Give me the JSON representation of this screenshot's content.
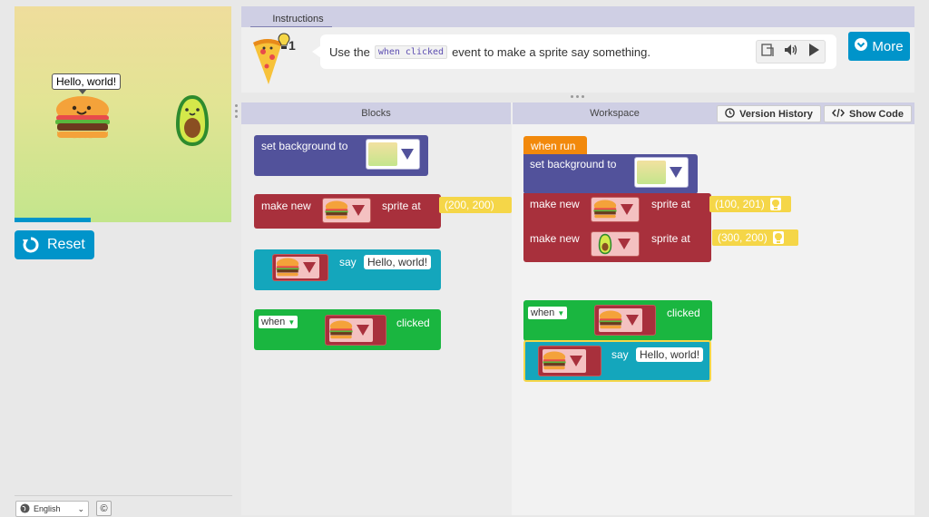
{
  "stage": {
    "speech_text": "Hello, world!",
    "reset_label": "Reset"
  },
  "footer": {
    "language": "English",
    "copyright_symbol": "©"
  },
  "instructions": {
    "tab_label": "Instructions",
    "hint_count": "1",
    "text_before": "Use the",
    "code_word": "when clicked",
    "text_after": "event to make a sprite say something.",
    "more_label": "More"
  },
  "toolbox": {
    "header": "Blocks",
    "set_background_label": "set background to",
    "make_new_label": "make new",
    "sprite_at_label": "sprite at",
    "make_new_coord": "(200, 200)",
    "say_label": "say",
    "say_text": "Hello, world!",
    "when_label": "when",
    "clicked_label": "clicked"
  },
  "workspace": {
    "header": "Workspace",
    "version_history_label": "Version History",
    "show_code_label": "Show Code",
    "when_run_label": "when run",
    "set_background_label": "set background to",
    "make_new_label": "make new",
    "sprite_at_label": "sprite at",
    "coord_1": "(100, 201)",
    "coord_2": "(300, 200)",
    "when_label": "when",
    "clicked_label": "clicked",
    "say_label": "say",
    "say_text": "Hello, world!"
  },
  "colors": {
    "accent_blue": "#0094ca",
    "block_purple": "#52529b",
    "block_red": "#a8303c",
    "block_teal": "#14a6bc",
    "block_green": "#1ab640",
    "block_orange": "#f2890c",
    "coord_yellow": "#f5d648"
  },
  "icons": [
    "reset-icon",
    "globe-icon",
    "pizza-icon",
    "lightbulb-icon",
    "translate-icon",
    "speaker-icon",
    "play-icon",
    "chevron-circle-down-icon",
    "clock-icon",
    "code-icon",
    "burger-icon",
    "avocado-icon"
  ]
}
